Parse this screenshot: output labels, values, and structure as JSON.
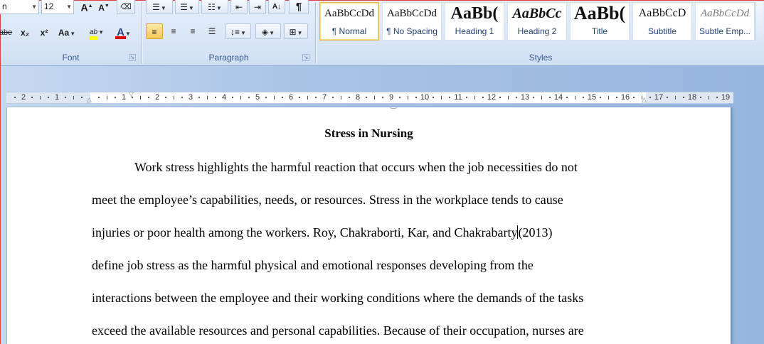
{
  "font_group": {
    "font_name": "n",
    "font_size": "12",
    "label": "Font",
    "grow_label": "A",
    "shrink_label": "A",
    "bold_label": "abe",
    "subscript_label": "x₂",
    "superscript_label": "x²",
    "change_case_label": "Aa",
    "highlight_label": "ab",
    "font_color_label": "A",
    "highlight_color": "#ffff00",
    "font_color": "#e00000"
  },
  "paragraph_group": {
    "label": "Paragraph",
    "show_marks_label": "¶"
  },
  "styles_group": {
    "label": "Styles",
    "tiles": [
      {
        "sample": "AaBbCcDd",
        "name": "¶ Normal"
      },
      {
        "sample": "AaBbCcDd",
        "name": "¶ No Spacing"
      },
      {
        "sample": "AaBb(",
        "name": "Heading 1"
      },
      {
        "sample": "AaBbCc",
        "name": "Heading 2"
      },
      {
        "sample": "AaBb(",
        "name": "Title"
      },
      {
        "sample": "AaBbCcD",
        "name": "Subtitle"
      },
      {
        "sample": "AaBbCcDd",
        "name": "Subtle Emp..."
      }
    ]
  },
  "ruler": {
    "left_numbers": [
      "2",
      "1"
    ],
    "right_numbers": [
      "1",
      "2",
      "3",
      "4",
      "5",
      "6",
      "7",
      "8",
      "9",
      "10",
      "11",
      "12",
      "13",
      "14",
      "15",
      "16",
      "17",
      "18",
      "19"
    ]
  },
  "document": {
    "title": "Stress in Nursing",
    "lines": [
      "Work stress highlights the harmful reaction that occurs when the job necessities do not",
      "meet the employee’s capabilities, needs, or resources. Stress in the workplace tends to cause",
      "injuries or poor health among the workers. Roy, Chakraborti, Kar, and Chakrabarty",
      "define job stress as the harmful physical and emotional responses developing from the",
      "interactions between the employee and their working conditions where the demands of the tasks",
      "exceed the available resources and personal capabilities. Because of their occupation, nurses are"
    ],
    "line3_after_caret": "(2013)"
  }
}
